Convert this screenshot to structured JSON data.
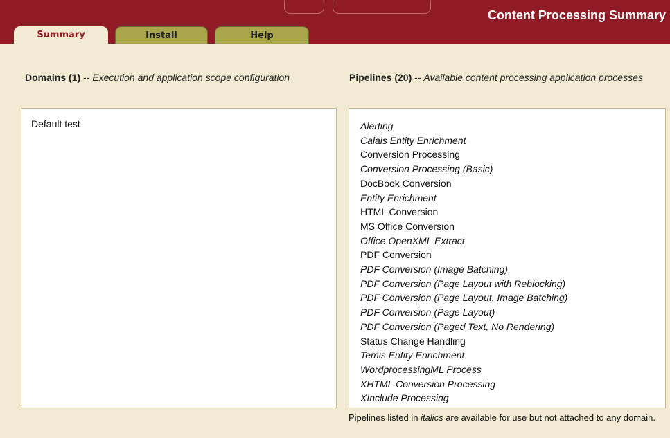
{
  "header": {
    "title": "Content Processing Summary",
    "color": "#8e1b26"
  },
  "tabs": [
    {
      "label": "Summary",
      "active": true
    },
    {
      "label": "Install",
      "active": false
    },
    {
      "label": "Help",
      "active": false
    }
  ],
  "domains": {
    "heading": "Domains (1)",
    "separator": " -- ",
    "description": "Execution and application scope configuration",
    "items": [
      "Default test"
    ]
  },
  "pipelines": {
    "heading": "Pipelines (20)",
    "separator": " -- ",
    "description": "Available content processing application processes",
    "items": [
      {
        "name": "Alerting",
        "italic": true
      },
      {
        "name": "Calais Entity Enrichment",
        "italic": true
      },
      {
        "name": "Conversion Processing",
        "italic": false
      },
      {
        "name": "Conversion Processing (Basic)",
        "italic": true
      },
      {
        "name": "DocBook Conversion",
        "italic": false
      },
      {
        "name": "Entity Enrichment",
        "italic": true
      },
      {
        "name": "HTML Conversion",
        "italic": false
      },
      {
        "name": "MS Office Conversion",
        "italic": false
      },
      {
        "name": "Office OpenXML Extract",
        "italic": true
      },
      {
        "name": "PDF Conversion",
        "italic": false
      },
      {
        "name": "PDF Conversion (Image Batching)",
        "italic": true
      },
      {
        "name": "PDF Conversion (Page Layout with Reblocking)",
        "italic": true
      },
      {
        "name": "PDF Conversion (Page Layout, Image Batching)",
        "italic": true
      },
      {
        "name": "PDF Conversion (Page Layout)",
        "italic": true
      },
      {
        "name": "PDF Conversion (Paged Text, No Rendering)",
        "italic": true
      },
      {
        "name": "Status Change Handling",
        "italic": false
      },
      {
        "name": "Temis Entity Enrichment",
        "italic": true
      },
      {
        "name": "WordprocessingML Process",
        "italic": true
      },
      {
        "name": "XHTML Conversion Processing",
        "italic": true
      },
      {
        "name": "XInclude Processing",
        "italic": true
      }
    ]
  },
  "note": {
    "before": "Pipelines listed in ",
    "emph": "italics",
    "after": " are available for use but not attached to any domain."
  }
}
